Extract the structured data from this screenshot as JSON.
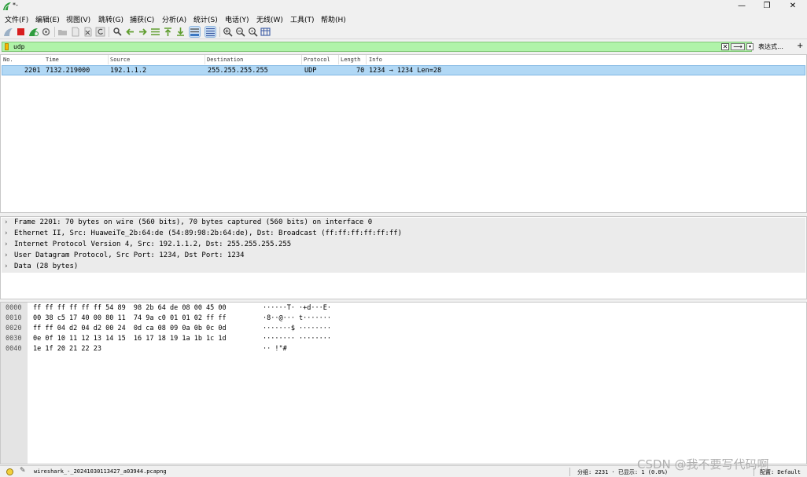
{
  "window": {
    "title": "*-",
    "controls": {
      "minimize": "—",
      "maximize": "❐",
      "close": "✕"
    }
  },
  "menu": [
    "文件(F)",
    "编辑(E)",
    "视图(V)",
    "跳转(G)",
    "捕获(C)",
    "分析(A)",
    "统计(S)",
    "电话(Y)",
    "无线(W)",
    "工具(T)",
    "帮助(H)"
  ],
  "toolbar": {
    "icons": [
      "shark-fin-start-icon",
      "stop-capture-icon",
      "restart-capture-icon",
      "capture-options-icon",
      "open-file-icon",
      "save-file-icon",
      "close-file-icon",
      "reload-icon",
      "find-packet-icon",
      "go-back-icon",
      "go-forward-icon",
      "go-to-packet-icon",
      "go-first-icon",
      "go-last-icon",
      "autoscroll-icon",
      "colorize-icon",
      "zoom-in-icon",
      "zoom-out-icon",
      "zoom-normal-icon",
      "resize-columns-icon"
    ],
    "selected": [
      "autoscroll-icon",
      "colorize-icon"
    ],
    "colors": {
      "stop": "#d81e1e",
      "start": "#5a9be0",
      "restart": "#2e9d3e"
    }
  },
  "filter": {
    "value": "udp",
    "clear": "✕",
    "apply": "⟶",
    "dropdown": "▾",
    "expression_label": "表达式…",
    "plus": "+",
    "bg_color": "#b0f3a9"
  },
  "packet_list": {
    "columns": [
      "No.",
      "Time",
      "Source",
      "Destination",
      "Protocol",
      "Length",
      "Info"
    ],
    "rows": [
      {
        "no": "2201",
        "time": "7132.219000",
        "source": "192.1.1.2",
        "destination": "255.255.255.255",
        "protocol": "UDP",
        "length": "70",
        "info": "1234 → 1234 Len=28"
      }
    ],
    "selected_color": "#b1d8f5"
  },
  "details": {
    "rows": [
      "Frame 2201: 70 bytes on wire (560 bits), 70 bytes captured (560 bits) on interface 0",
      "Ethernet II, Src: HuaweiTe_2b:64:de (54:89:98:2b:64:de), Dst: Broadcast (ff:ff:ff:ff:ff:ff)",
      "Internet Protocol Version 4, Src: 192.1.1.2, Dst: 255.255.255.255",
      "User Datagram Protocol, Src Port: 1234, Dst Port: 1234",
      "Data (28 bytes)"
    ],
    "arrow": "›"
  },
  "hex": {
    "rows": [
      {
        "offset": "0000",
        "bytes": "ff ff ff ff ff ff 54 89  98 2b 64 de 08 00 45 00",
        "ascii": "······T· ·+d···E·"
      },
      {
        "offset": "0010",
        "bytes": "00 38 c5 17 40 00 80 11  74 9a c0 01 01 02 ff ff",
        "ascii": "·8··@··· t·······"
      },
      {
        "offset": "0020",
        "bytes": "ff ff 04 d2 04 d2 00 24  0d ca 08 09 0a 0b 0c 0d",
        "ascii": "·······$ ········"
      },
      {
        "offset": "0030",
        "bytes": "0e 0f 10 11 12 13 14 15  16 17 18 19 1a 1b 1c 1d",
        "ascii": "········ ········"
      },
      {
        "offset": "0040",
        "bytes": "1e 1f 20 21 22 23",
        "ascii": "·· !\"#"
      }
    ]
  },
  "status": {
    "edit_icon": "✎",
    "file": "wireshark_-_20241030113427_a03944.pcapng",
    "stats": "分组: 2231 · 已显示: 1 (0.0%)",
    "profile": "配置: Default"
  },
  "watermark": "CSDN @我不要写代码啊"
}
